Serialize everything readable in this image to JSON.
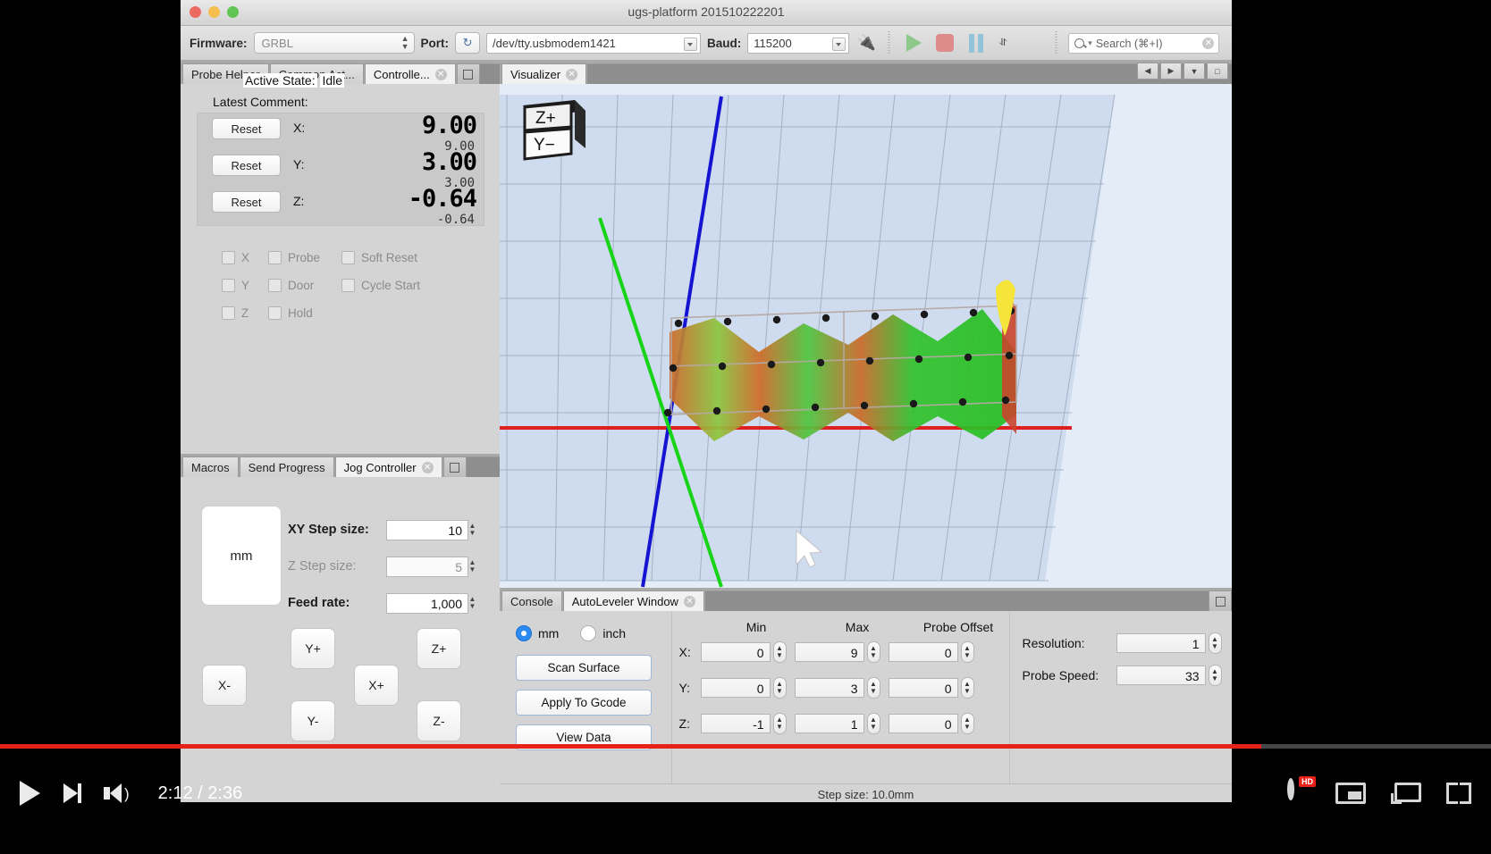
{
  "window": {
    "title": "ugs-platform 201510222201",
    "traffic_lights": [
      "close",
      "minimize",
      "zoom"
    ]
  },
  "toolbar": {
    "firmware_label": "Firmware:",
    "firmware_value": "GRBL",
    "port_label": "Port:",
    "port_value": "/dev/tty.usbmodem1421",
    "refresh_icon": "refresh-icon",
    "baud_label": "Baud:",
    "baud_value": "115200",
    "connect_icon": "plug-icon",
    "play_icon": "play-icon",
    "stop_icon": "stop-icon",
    "pause_icon": "pause-icon",
    "overflow_icon": "chevron-double-down-icon",
    "search_placeholder": "Search (⌘+I)",
    "search_value": "",
    "search_icon": "search-icon",
    "clear_icon": "clear-icon"
  },
  "left_top_tabs": [
    {
      "label": "Probe Helper",
      "active": false,
      "closable": false
    },
    {
      "label": "Common Act...",
      "active": false,
      "closable": false
    },
    {
      "label": "Controlle...",
      "active": true,
      "closable": true
    }
  ],
  "controller": {
    "active_state_label": "Active State:",
    "active_state_value": "Idle",
    "latest_comment_label": "Latest Comment:",
    "latest_comment_value": "",
    "reset_label": "Reset",
    "axes": [
      {
        "label": "X:",
        "work": "9.00",
        "machine": "9.00"
      },
      {
        "label": "Y:",
        "work": "3.00",
        "machine": "3.00"
      },
      {
        "label": "Z:",
        "work": "-0.64",
        "machine": "-0.64"
      }
    ],
    "checkboxes": [
      [
        "X",
        "Probe",
        "Soft Reset"
      ],
      [
        "Y",
        "Door",
        "Cycle Start"
      ],
      [
        "Z",
        "Hold",
        ""
      ]
    ]
  },
  "left_bottom_tabs": [
    {
      "label": "Macros",
      "active": false,
      "closable": false
    },
    {
      "label": "Send Progress",
      "active": false,
      "closable": false
    },
    {
      "label": "Jog Controller",
      "active": true,
      "closable": true
    }
  ],
  "jog": {
    "units": "mm",
    "xy_step_label": "XY Step size:",
    "xy_step_value": "10",
    "z_step_label": "Z Step size:",
    "z_step_value": "5",
    "feed_label": "Feed rate:",
    "feed_value": "1,000",
    "buttons": [
      "Y+",
      "Z+",
      "X-",
      "X+",
      "Y-",
      "Z-"
    ]
  },
  "visualizer": {
    "tab_label": "Visualizer",
    "cube_top": "Z+",
    "cube_front": "Y−",
    "nav_icons": [
      "nav-left-icon",
      "nav-right-icon",
      "nav-dropdown-icon",
      "nav-maximize-icon"
    ]
  },
  "bottom_tabs": [
    {
      "label": "Console",
      "active": false,
      "closable": false
    },
    {
      "label": "AutoLeveler Window",
      "active": true,
      "closable": true
    }
  ],
  "autoleveler": {
    "unit_mm": "mm",
    "unit_inch": "inch",
    "selected_unit": "mm",
    "scan_surface": "Scan Surface",
    "apply_to_gcode": "Apply To Gcode",
    "view_data": "View Data",
    "headers": [
      "Min",
      "Max",
      "Probe Offset"
    ],
    "rows": [
      {
        "axis": "X:",
        "min": "0",
        "max": "9",
        "offset": "0"
      },
      {
        "axis": "Y:",
        "min": "0",
        "max": "3",
        "offset": "0"
      },
      {
        "axis": "Z:",
        "min": "-1",
        "max": "1",
        "offset": "0"
      }
    ],
    "resolution_label": "Resolution:",
    "resolution_value": "1",
    "probe_speed_label": "Probe Speed:",
    "probe_speed_value": "33"
  },
  "status": {
    "step_size": "Step size: 10.0mm"
  },
  "player": {
    "play_icon": "play-icon",
    "next_icon": "next-video-icon",
    "volume_icon": "volume-icon",
    "time": "2:12 / 2:36",
    "current_time": "2:12",
    "duration": "2:36",
    "progress_percent": 84.6,
    "settings_icon": "gear-icon",
    "hd_badge": "HD",
    "miniplayer_icon": "miniplayer-icon",
    "cast_icon": "cast-icon",
    "fullscreen_icon": "fullscreen-icon",
    "accent_color": "#e62117"
  }
}
